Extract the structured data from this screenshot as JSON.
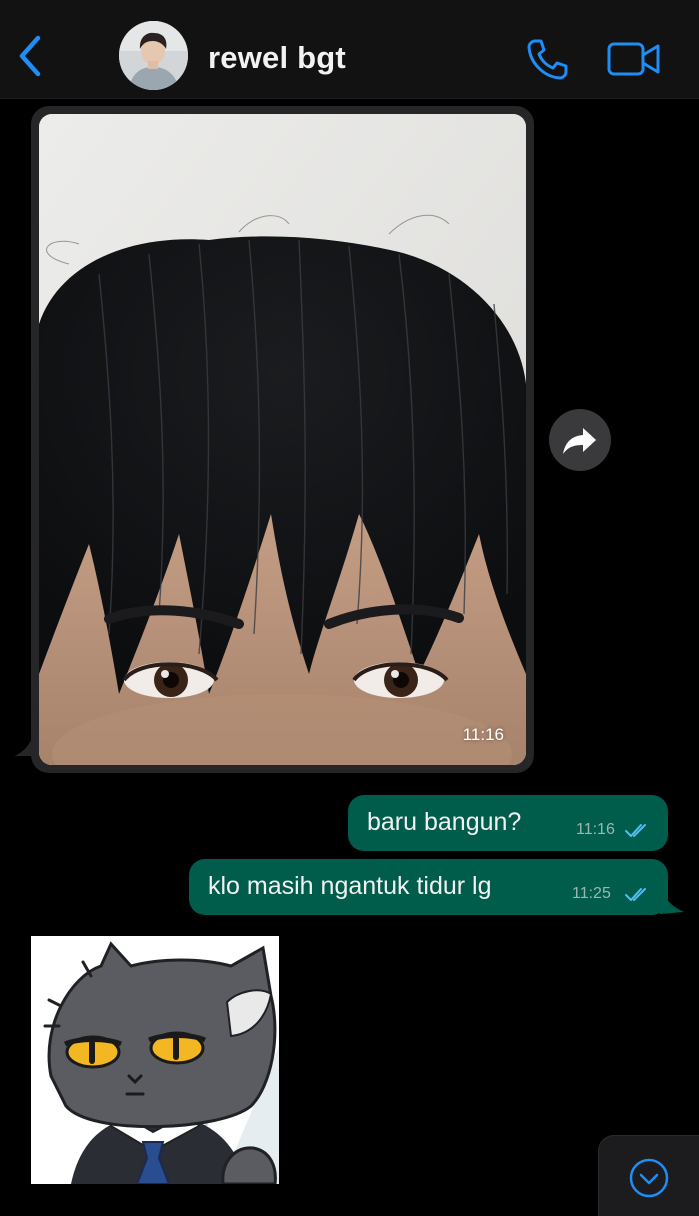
{
  "header": {
    "contact_name": "rewel bgt",
    "back_icon": "chevron-left-icon",
    "call_icon": "phone-icon",
    "video_icon": "video-camera-icon",
    "accent_color": "#1e8ef5"
  },
  "messages": [
    {
      "type": "image",
      "direction": "incoming",
      "time": "11:16"
    },
    {
      "type": "text",
      "direction": "outgoing",
      "text": "baru bangun?",
      "time": "11:16",
      "status_icon": "double-check-icon"
    },
    {
      "type": "text",
      "direction": "outgoing",
      "text": "klo masih ngantuk tidur lg",
      "time": "11:25",
      "status_icon": "double-check-icon"
    },
    {
      "type": "sticker",
      "direction": "incoming"
    }
  ],
  "controls": {
    "forward_icon": "forward-arrow-icon",
    "scroll_down_icon": "chevron-down-circle-icon"
  },
  "colors": {
    "background": "#000000",
    "header_bg": "#121212",
    "outgoing_bubble": "#005c4b",
    "incoming_bubble": "#262628",
    "read_ticks": "#53bdeb"
  }
}
